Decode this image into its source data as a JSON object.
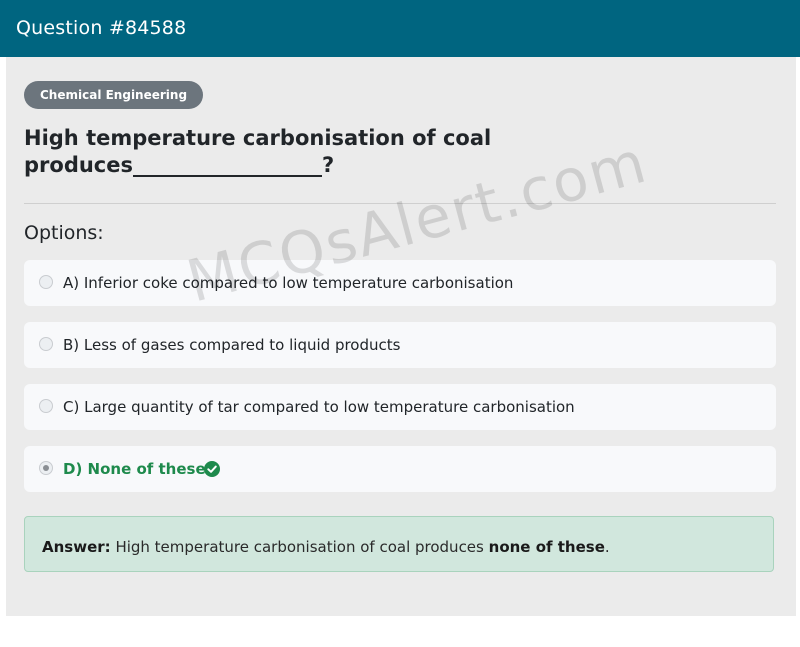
{
  "header": {
    "title": "Question #84588",
    "background": "#006580"
  },
  "category": "Chemical Engineering",
  "question": "High temperature carbonisation of coal produces__________________?",
  "options_label": "Options:",
  "options": [
    {
      "label": "A) Inferior coke compared to low temperature carbonisation",
      "selected": false,
      "correct": false
    },
    {
      "label": "B) Less of gases compared to liquid products",
      "selected": false,
      "correct": false
    },
    {
      "label": "C) Large quantity of tar compared to low temperature carbonisation",
      "selected": false,
      "correct": false
    },
    {
      "label": "D) None of these",
      "selected": true,
      "correct": true,
      "icon": "check-circle-icon"
    }
  ],
  "answer": {
    "label": "Answer:",
    "text": "High temperature carbonisation of coal produces",
    "emphasis": "none of these",
    "suffix": "."
  },
  "watermark": "MCQsAlert.com",
  "colors": {
    "correct": "#1e8a4c",
    "answer_bg": "#d1e7dd",
    "badge_bg": "#6c757d"
  }
}
